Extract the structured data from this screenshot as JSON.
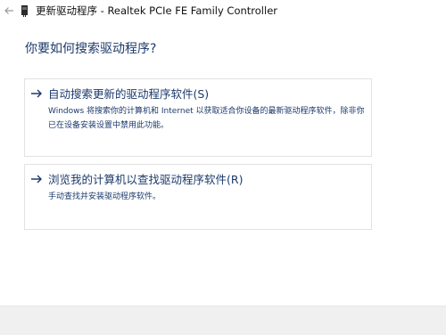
{
  "titlebar": {
    "back_icon": "back-arrow-icon",
    "device_icon": "network-adapter-icon",
    "title": "更新驱动程序 - Realtek PCIe FE Family Controller"
  },
  "main": {
    "question": "你要如何搜索驱动程序?",
    "options": [
      {
        "icon": "arrow-right-icon",
        "title": "自动搜索更新的驱动程序软件(S)",
        "description": "Windows 将搜索你的计算机和 Internet 以获取适合你设备的最新驱动程序软件，除非你已在设备安装设置中禁用此功能。"
      },
      {
        "icon": "arrow-right-icon",
        "title": "浏览我的计算机以查找驱动程序软件(R)",
        "description": "手动查找并安装驱动程序软件。"
      }
    ]
  },
  "colors": {
    "link_blue": "#1c3a6b",
    "border": "#e2e2e2",
    "footer_bg": "#f0f0f0"
  }
}
